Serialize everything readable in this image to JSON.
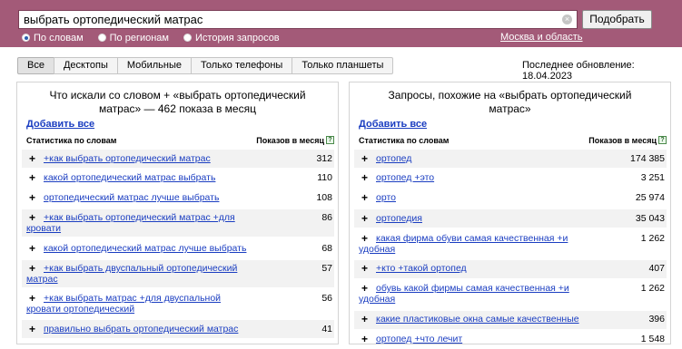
{
  "search": {
    "query": "выбрать ортопедический матрас",
    "button": "Подобрать"
  },
  "radios": [
    {
      "label": "По словам",
      "selected": true
    },
    {
      "label": "По регионам",
      "selected": false
    },
    {
      "label": "История запросов",
      "selected": false
    }
  ],
  "region": "Москва и область",
  "tabs": [
    "Все",
    "Десктопы",
    "Мобильные",
    "Только телефоны",
    "Только планшеты"
  ],
  "last_update": "Последнее обновление: 18.04.2023",
  "left": {
    "title": "Что искали со словом + «выбрать ортопедический матрас» — 462 показа в месяц",
    "add_all": "Добавить все",
    "col_stats": "Статистика по словам",
    "col_shows": "Показов в месяц",
    "help": "?",
    "rows": [
      {
        "phrase": "+как выбрать ортопедический матрас",
        "count": "312"
      },
      {
        "phrase": "какой ортопедический матрас выбрать",
        "count": "110"
      },
      {
        "phrase": "ортопедический матрас лучше выбрать",
        "count": "108"
      },
      {
        "phrase": "+как выбрать ортопедический матрас +для кровати",
        "count": "86"
      },
      {
        "phrase": "какой ортопедический матрас лучше выбрать",
        "count": "68"
      },
      {
        "phrase": "+как выбрать двуспальный ортопедический матрас",
        "count": "57"
      },
      {
        "phrase": "+как выбрать матрас +для двуспальной кровати ортопедический",
        "count": "56"
      },
      {
        "phrase": "правильно выбрать ортопедический матрас",
        "count": "41"
      }
    ]
  },
  "right": {
    "title": "Запросы, похожие на «выбрать ортопедический матрас»",
    "add_all": "Добавить все",
    "col_stats": "Статистика по словам",
    "col_shows": "Показов в месяц",
    "help": "?",
    "rows": [
      {
        "phrase": "ортопед",
        "count": "174 385"
      },
      {
        "phrase": "ортопед +это",
        "count": "3 251"
      },
      {
        "phrase": "орто",
        "count": "25 974"
      },
      {
        "phrase": "ортопедия",
        "count": "35 043"
      },
      {
        "phrase": "какая фирма обуви самая качественная +и удобная",
        "count": "1 262"
      },
      {
        "phrase": "+кто +такой ортопед",
        "count": "407"
      },
      {
        "phrase": "обувь какой фирмы самая качественная +и удобная",
        "count": "1 262"
      },
      {
        "phrase": "какие пластиковые окна самые качественные",
        "count": "396"
      },
      {
        "phrase": "ортопед +что лечит",
        "count": "1 548"
      }
    ]
  }
}
